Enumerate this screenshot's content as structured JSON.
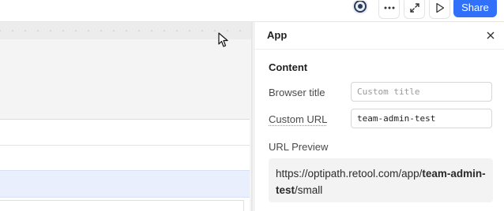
{
  "toolbar": {
    "share_label": "Share",
    "icons": [
      "app-avatar-icon",
      "more-icon",
      "expand-icon",
      "play-icon"
    ]
  },
  "panel": {
    "title": "App",
    "section_title": "Content",
    "browser_title": {
      "label": "Browser title",
      "value": "",
      "placeholder": "Custom title"
    },
    "custom_url": {
      "label": "Custom URL",
      "value": "team-admin-test"
    },
    "url_preview": {
      "label": "URL Preview",
      "prefix": "https://optipath.retool.com/app/",
      "slug": "team-admin-test",
      "suffix": "/small"
    }
  },
  "colors": {
    "accent": "#3170f9",
    "selected_row": "#e9effd",
    "canvas_bg": "#f4f4f4"
  }
}
